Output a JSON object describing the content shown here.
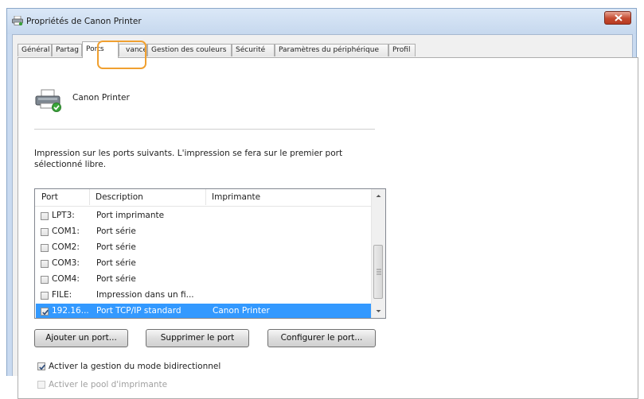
{
  "window": {
    "title": "Propriétés de Canon Printer"
  },
  "tabs": [
    {
      "label": "Général"
    },
    {
      "label": "Partag"
    },
    {
      "label": "Ports"
    },
    {
      "label": "vancé"
    },
    {
      "label": "Gestion des couleurs"
    },
    {
      "label": "Sécurité"
    },
    {
      "label": "Paramètres du périphérique"
    },
    {
      "label": "Profil"
    }
  ],
  "printer": {
    "name": "Canon Printer"
  },
  "description": "Impression sur les ports suivants. L'impression se fera sur le premier port sélectionné libre.",
  "list": {
    "headers": {
      "port": "Port",
      "description": "Description",
      "printer": "Imprimante"
    },
    "rows": [
      {
        "port": "LPT3:",
        "description": "Port imprimante",
        "printer": "",
        "checked": false,
        "selected": false
      },
      {
        "port": "COM1:",
        "description": "Port série",
        "printer": "",
        "checked": false,
        "selected": false
      },
      {
        "port": "COM2:",
        "description": "Port série",
        "printer": "",
        "checked": false,
        "selected": false
      },
      {
        "port": "COM3:",
        "description": "Port série",
        "printer": "",
        "checked": false,
        "selected": false
      },
      {
        "port": "COM4:",
        "description": "Port série",
        "printer": "",
        "checked": false,
        "selected": false
      },
      {
        "port": "FILE:",
        "description": "Impression dans un fi...",
        "printer": "",
        "checked": false,
        "selected": false
      },
      {
        "port": "192.16...",
        "description": "Port TCP/IP standard",
        "printer": "Canon Printer",
        "checked": true,
        "selected": true
      }
    ]
  },
  "buttons": {
    "add": "Ajouter un port...",
    "delete": "Supprimer le port",
    "configure": "Configurer le port..."
  },
  "options": {
    "bidirectional": {
      "label": "Activer la gestion du mode bidirectionnel",
      "checked": true,
      "enabled": true
    },
    "pooling": {
      "label": "Activer le pool d'imprimante",
      "checked": false,
      "enabled": false
    }
  },
  "colors": {
    "selection": "#3399ff",
    "highlight": "#f0a030",
    "titlebar": "#c9daf0"
  }
}
